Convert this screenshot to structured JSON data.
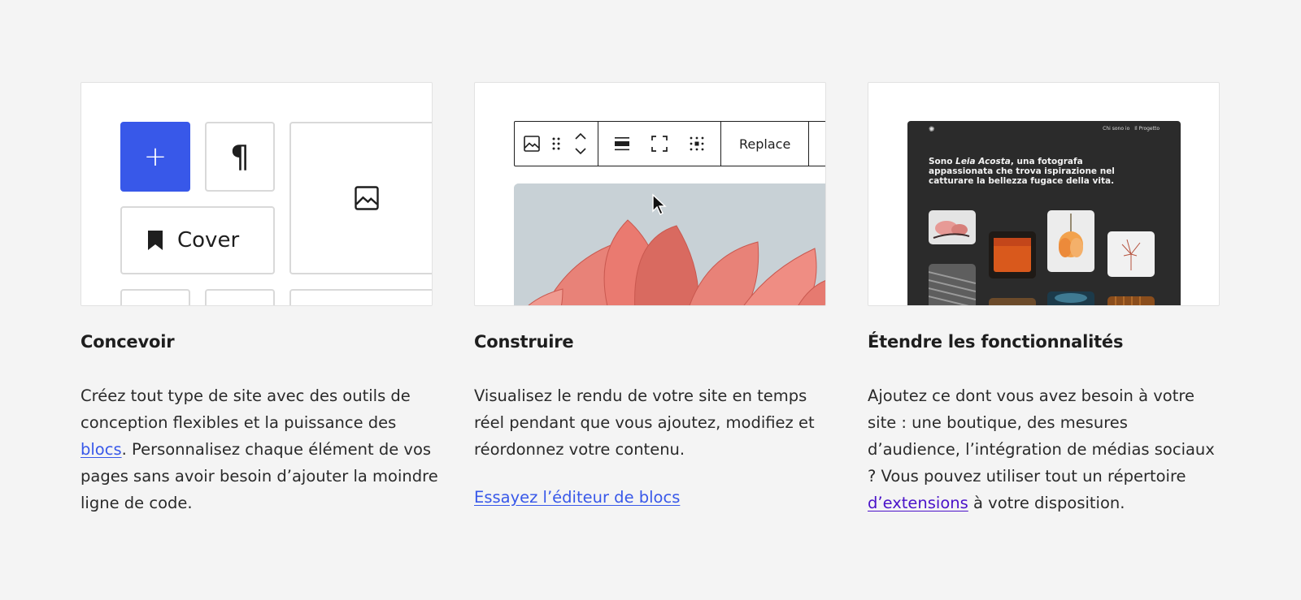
{
  "features": [
    {
      "title": "Concevoir",
      "text_before": "Créez tout type de site avec des outils de conception flexibles et la puissance des ",
      "link_text": "blocs",
      "text_after": ". Personnalisez chaque élément de vos pages sans avoir besoin d’ajouter la moindre ligne de code.",
      "illustration": {
        "plus_glyph": "+",
        "paragraph_glyph": "¶",
        "cover_label": "Cover",
        "icons": [
          "plus-icon",
          "paragraph-icon",
          "image-icon",
          "bookmark-icon"
        ]
      }
    },
    {
      "title": "Construire",
      "text": "Visualisez le rendu de votre site en temps réel pendant que vous ajoutez, modifiez et réordonnez votre contenu.",
      "cta": "Essayez l’éditeur de blocs",
      "illustration": {
        "replace_label": "Replace",
        "icons": [
          "image-icon",
          "drag-handle-icon",
          "move-up-down-icon",
          "align-icon",
          "fullscreen-icon",
          "grid-icon",
          "cursor-icon"
        ]
      }
    },
    {
      "title": "Étendre les fonctionnalités",
      "text_before": "Ajoutez ce dont vous avez besoin à votre site : une boutique, des mesures d’audience, l’intégration de médias sociaux ? Vous pouvez utiliser tout un répertoire ",
      "link_text": "d’extensions",
      "text_after": " à votre disposition.",
      "illustration": {
        "logo_glyph": "✺",
        "nav": [
          "Chi sono io",
          "Il Progetto"
        ],
        "intro_before": "Sono ",
        "intro_name": "Leia Acosta",
        "intro_after": ", una fotografa appassionata che trova ispirazione nel catturare la bellezza fugace della vita."
      }
    }
  ],
  "colors": {
    "accent": "#3858e9",
    "visited_link": "#4a12c9",
    "page_bg": "#f4f4f4",
    "dark_preview": "#2b2b2b"
  }
}
